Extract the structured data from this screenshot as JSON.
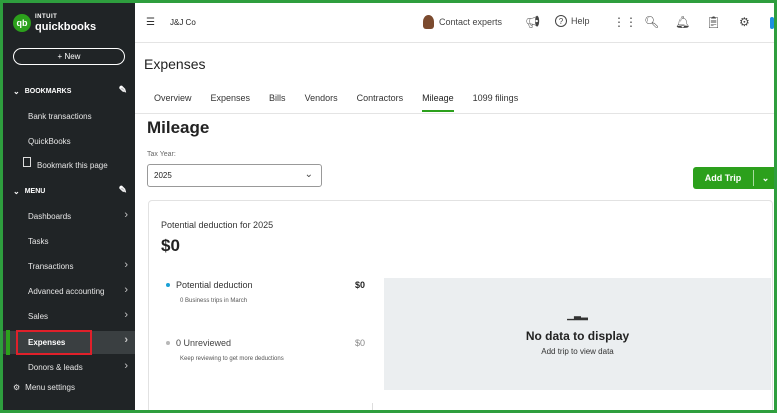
{
  "sidebar": {
    "logo_brand": "INTUIT",
    "logo_name": "quickbooks",
    "new_button": "+ New",
    "bookmarks_heading": "BOOKMARKS",
    "bookmarks": [
      "Bank transactions",
      "QuickBooks",
      "Bookmark this page"
    ],
    "menu_heading": "MENU",
    "menu_items": [
      "Dashboards",
      "Tasks",
      "Transactions",
      "Advanced accounting",
      "Sales",
      "Expenses",
      "Donors & leads"
    ],
    "active_item": "Expenses",
    "menu_settings": "Menu settings"
  },
  "topbar": {
    "company": "J&J Co",
    "contact": "Contact experts",
    "help": "Help"
  },
  "page": {
    "title": "Expenses",
    "tabs": [
      "Overview",
      "Expenses",
      "Bills",
      "Vendors",
      "Contractors",
      "Mileage",
      "1099 filings"
    ],
    "active_tab": "Mileage",
    "section_title": "Mileage",
    "tax_year_label": "Tax Year:",
    "tax_year_value": "2025",
    "add_trip": "Add Trip"
  },
  "summary": {
    "title": "Potential deduction for 2025",
    "amount": "$0",
    "metrics": [
      {
        "label": "Potential deduction",
        "sub": "0 Business trips in March",
        "value": "$0",
        "color": "#1aa1d6"
      },
      {
        "label": "0 Unreviewed",
        "sub": "Keep reviewing to get more deductions",
        "value": "$0",
        "color": "#b8b8b8"
      }
    ],
    "empty_title": "No data to display",
    "empty_sub": "Add trip to view data"
  },
  "colors": {
    "accent": "#2ca01c",
    "sidebar_bg": "#202426",
    "highlight": "#e0202a"
  }
}
